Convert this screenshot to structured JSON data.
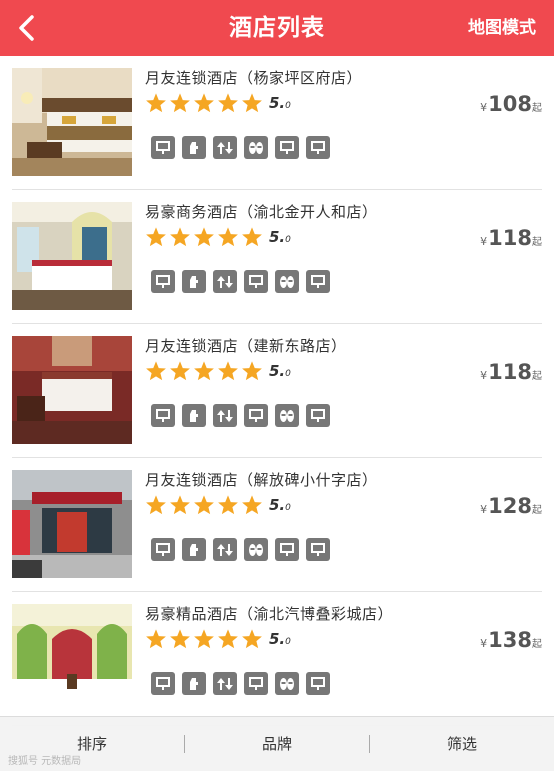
{
  "header": {
    "title": "酒店列表",
    "map_mode_label": "地图模式",
    "back_icon": "chevron-left-icon",
    "background": "#f0494f"
  },
  "hotels": [
    {
      "name": "月友连锁酒店（杨家坪区府店）",
      "stars": 5,
      "score_main": "5.",
      "score_sub": "0",
      "currency": "¥",
      "price": "108",
      "price_unit": "起",
      "amenities": [
        "wifi-icon",
        "towel-icon",
        "elevator-icon",
        "slippers-icon",
        "wifi-icon",
        "wifi-icon"
      ]
    },
    {
      "name": "易豪商务酒店（渝北金开人和店）",
      "stars": 5,
      "score_main": "5.",
      "score_sub": "0",
      "currency": "¥",
      "price": "118",
      "price_unit": "起",
      "amenities": [
        "wifi-icon",
        "towel-icon",
        "elevator-icon",
        "wifi-icon",
        "slippers-icon",
        "wifi-icon"
      ]
    },
    {
      "name": "月友连锁酒店（建新东路店）",
      "stars": 5,
      "score_main": "5.",
      "score_sub": "0",
      "currency": "¥",
      "price": "118",
      "price_unit": "起",
      "amenities": [
        "wifi-icon",
        "towel-icon",
        "elevator-icon",
        "wifi-icon",
        "slippers-icon",
        "wifi-icon"
      ]
    },
    {
      "name": "月友连锁酒店（解放碑小什字店）",
      "stars": 5,
      "score_main": "5.",
      "score_sub": "0",
      "currency": "¥",
      "price": "128",
      "price_unit": "起",
      "amenities": [
        "wifi-icon",
        "towel-icon",
        "elevator-icon",
        "slippers-icon",
        "wifi-icon",
        "wifi-icon"
      ]
    },
    {
      "name": "易豪精品酒店（渝北汽博叠彩城店）",
      "stars": 5,
      "score_main": "5.",
      "score_sub": "0",
      "currency": "¥",
      "price": "138",
      "price_unit": "起",
      "amenities": [
        "wifi-icon",
        "towel-icon",
        "elevator-icon",
        "wifi-icon",
        "slippers-icon",
        "wifi-icon"
      ]
    }
  ],
  "bottom_bar": {
    "sort_label": "排序",
    "brand_label": "品牌",
    "filter_label": "筛选"
  },
  "watermark": "搜狐号 元数据局",
  "colors": {
    "star": "#f5a623",
    "amenity_bg": "#777777",
    "accent": "#f0494f"
  }
}
